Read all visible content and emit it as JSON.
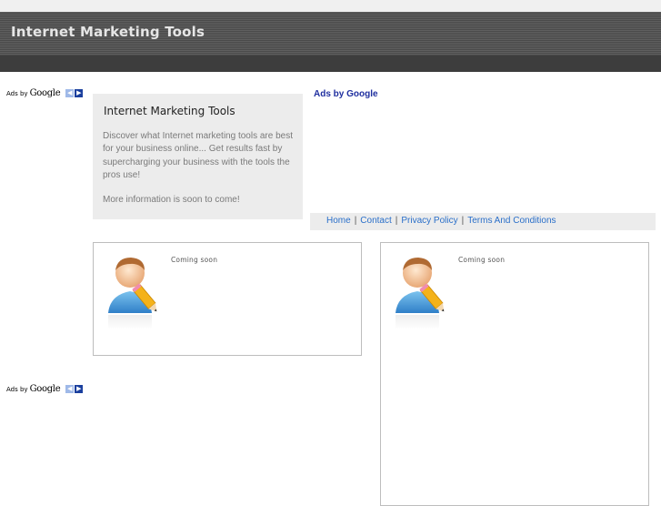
{
  "header": {
    "title": "Internet Marketing Tools"
  },
  "ad_units": [
    {
      "label": "Ads by",
      "brand": "Google"
    },
    {
      "label": "Ads by",
      "brand": "Google"
    }
  ],
  "intro": {
    "heading": "Internet Marketing Tools",
    "paragraph": "Discover what Internet marketing tools are best for your business online... Get results fast by supercharging your business with the tools the pros use!",
    "note": "More information is soon to come!"
  },
  "ads_title": "Ads by Google",
  "nav": {
    "items": [
      "Home",
      "Contact",
      "Privacy Policy",
      "Terms And Conditions"
    ],
    "separator": "|"
  },
  "cards": [
    {
      "status": "Coming soon",
      "icon": "user-edit-icon"
    },
    {
      "status": "Coming soon",
      "icon": "user-edit-icon"
    }
  ],
  "colors": {
    "header_bg": "#4a4a4a",
    "header_text": "#e6e6e6",
    "link": "#2a6fc9",
    "ads_title": "#1f2f9f",
    "panel_bg": "#ececec"
  }
}
